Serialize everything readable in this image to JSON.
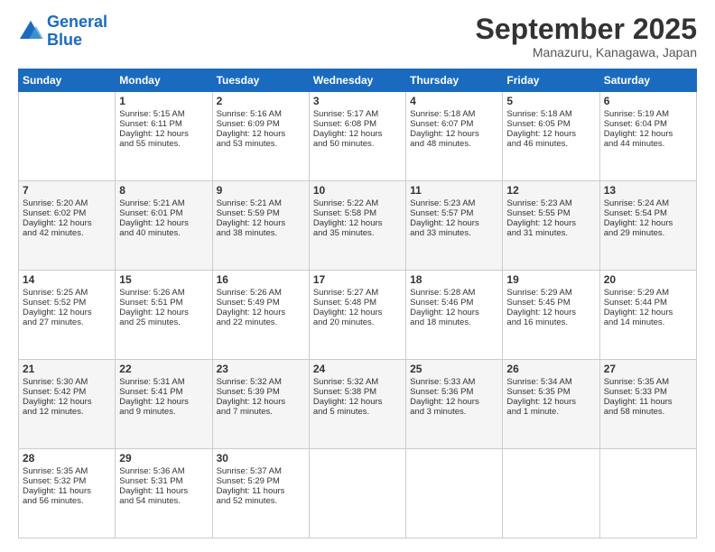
{
  "header": {
    "logo_line1": "General",
    "logo_line2": "Blue",
    "month": "September 2025",
    "location": "Manazuru, Kanagawa, Japan"
  },
  "days_of_week": [
    "Sunday",
    "Monday",
    "Tuesday",
    "Wednesday",
    "Thursday",
    "Friday",
    "Saturday"
  ],
  "weeks": [
    {
      "row_class": "white-row",
      "cells": [
        {
          "day": "",
          "content": ""
        },
        {
          "day": "1",
          "content": "Sunrise: 5:15 AM\nSunset: 6:11 PM\nDaylight: 12 hours\nand 55 minutes."
        },
        {
          "day": "2",
          "content": "Sunrise: 5:16 AM\nSunset: 6:09 PM\nDaylight: 12 hours\nand 53 minutes."
        },
        {
          "day": "3",
          "content": "Sunrise: 5:17 AM\nSunset: 6:08 PM\nDaylight: 12 hours\nand 50 minutes."
        },
        {
          "day": "4",
          "content": "Sunrise: 5:18 AM\nSunset: 6:07 PM\nDaylight: 12 hours\nand 48 minutes."
        },
        {
          "day": "5",
          "content": "Sunrise: 5:18 AM\nSunset: 6:05 PM\nDaylight: 12 hours\nand 46 minutes."
        },
        {
          "day": "6",
          "content": "Sunrise: 5:19 AM\nSunset: 6:04 PM\nDaylight: 12 hours\nand 44 minutes."
        }
      ]
    },
    {
      "row_class": "gray-row",
      "cells": [
        {
          "day": "7",
          "content": "Sunrise: 5:20 AM\nSunset: 6:02 PM\nDaylight: 12 hours\nand 42 minutes."
        },
        {
          "day": "8",
          "content": "Sunrise: 5:21 AM\nSunset: 6:01 PM\nDaylight: 12 hours\nand 40 minutes."
        },
        {
          "day": "9",
          "content": "Sunrise: 5:21 AM\nSunset: 5:59 PM\nDaylight: 12 hours\nand 38 minutes."
        },
        {
          "day": "10",
          "content": "Sunrise: 5:22 AM\nSunset: 5:58 PM\nDaylight: 12 hours\nand 35 minutes."
        },
        {
          "day": "11",
          "content": "Sunrise: 5:23 AM\nSunset: 5:57 PM\nDaylight: 12 hours\nand 33 minutes."
        },
        {
          "day": "12",
          "content": "Sunrise: 5:23 AM\nSunset: 5:55 PM\nDaylight: 12 hours\nand 31 minutes."
        },
        {
          "day": "13",
          "content": "Sunrise: 5:24 AM\nSunset: 5:54 PM\nDaylight: 12 hours\nand 29 minutes."
        }
      ]
    },
    {
      "row_class": "white-row",
      "cells": [
        {
          "day": "14",
          "content": "Sunrise: 5:25 AM\nSunset: 5:52 PM\nDaylight: 12 hours\nand 27 minutes."
        },
        {
          "day": "15",
          "content": "Sunrise: 5:26 AM\nSunset: 5:51 PM\nDaylight: 12 hours\nand 25 minutes."
        },
        {
          "day": "16",
          "content": "Sunrise: 5:26 AM\nSunset: 5:49 PM\nDaylight: 12 hours\nand 22 minutes."
        },
        {
          "day": "17",
          "content": "Sunrise: 5:27 AM\nSunset: 5:48 PM\nDaylight: 12 hours\nand 20 minutes."
        },
        {
          "day": "18",
          "content": "Sunrise: 5:28 AM\nSunset: 5:46 PM\nDaylight: 12 hours\nand 18 minutes."
        },
        {
          "day": "19",
          "content": "Sunrise: 5:29 AM\nSunset: 5:45 PM\nDaylight: 12 hours\nand 16 minutes."
        },
        {
          "day": "20",
          "content": "Sunrise: 5:29 AM\nSunset: 5:44 PM\nDaylight: 12 hours\nand 14 minutes."
        }
      ]
    },
    {
      "row_class": "gray-row",
      "cells": [
        {
          "day": "21",
          "content": "Sunrise: 5:30 AM\nSunset: 5:42 PM\nDaylight: 12 hours\nand 12 minutes."
        },
        {
          "day": "22",
          "content": "Sunrise: 5:31 AM\nSunset: 5:41 PM\nDaylight: 12 hours\nand 9 minutes."
        },
        {
          "day": "23",
          "content": "Sunrise: 5:32 AM\nSunset: 5:39 PM\nDaylight: 12 hours\nand 7 minutes."
        },
        {
          "day": "24",
          "content": "Sunrise: 5:32 AM\nSunset: 5:38 PM\nDaylight: 12 hours\nand 5 minutes."
        },
        {
          "day": "25",
          "content": "Sunrise: 5:33 AM\nSunset: 5:36 PM\nDaylight: 12 hours\nand 3 minutes."
        },
        {
          "day": "26",
          "content": "Sunrise: 5:34 AM\nSunset: 5:35 PM\nDaylight: 12 hours\nand 1 minute."
        },
        {
          "day": "27",
          "content": "Sunrise: 5:35 AM\nSunset: 5:33 PM\nDaylight: 11 hours\nand 58 minutes."
        }
      ]
    },
    {
      "row_class": "white-row",
      "cells": [
        {
          "day": "28",
          "content": "Sunrise: 5:35 AM\nSunset: 5:32 PM\nDaylight: 11 hours\nand 56 minutes."
        },
        {
          "day": "29",
          "content": "Sunrise: 5:36 AM\nSunset: 5:31 PM\nDaylight: 11 hours\nand 54 minutes."
        },
        {
          "day": "30",
          "content": "Sunrise: 5:37 AM\nSunset: 5:29 PM\nDaylight: 11 hours\nand 52 minutes."
        },
        {
          "day": "",
          "content": ""
        },
        {
          "day": "",
          "content": ""
        },
        {
          "day": "",
          "content": ""
        },
        {
          "day": "",
          "content": ""
        }
      ]
    }
  ]
}
